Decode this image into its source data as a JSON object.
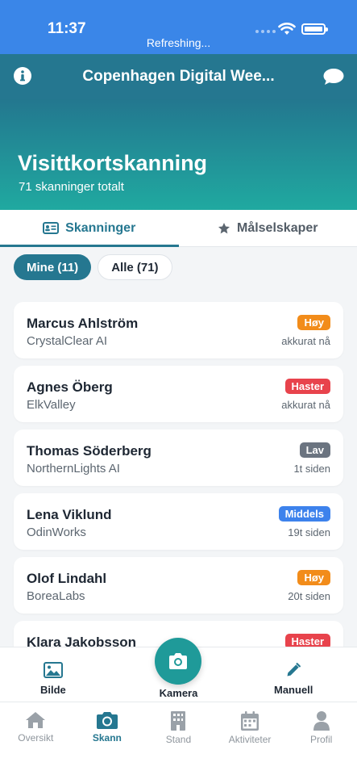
{
  "status_bar": {
    "time": "11:37",
    "refresh_text": "Refreshing..."
  },
  "navbar": {
    "title": "Copenhagen Digital Wee...",
    "left_icon": "info-icon",
    "right_icon": "chat-bubble-icon"
  },
  "hero": {
    "title": "Visittkortskanning",
    "subtitle": "71 skanninger totalt"
  },
  "tabs": [
    {
      "label": "Skanninger",
      "icon": "contact-card-icon",
      "active": true
    },
    {
      "label": "Målselskaper",
      "icon": "star-icon",
      "active": false
    }
  ],
  "filters": [
    {
      "label": "Mine (11)",
      "active": true
    },
    {
      "label": "Alle (71)",
      "active": false
    }
  ],
  "scans": [
    {
      "name": "Marcus Ahlström",
      "company": "CrystalClear AI",
      "priority": "Høy",
      "priority_color": "#f28c1a",
      "time": "akkurat nå"
    },
    {
      "name": "Agnes Öberg",
      "company": "ElkValley",
      "priority": "Haster",
      "priority_color": "#e8434c",
      "time": "akkurat nå"
    },
    {
      "name": "Thomas Söderberg",
      "company": "NorthernLights AI",
      "priority": "Lav",
      "priority_color": "#6b7480",
      "time": "1t siden"
    },
    {
      "name": "Lena Viklund",
      "company": "OdinWorks",
      "priority": "Middels",
      "priority_color": "#3d82ec",
      "time": "19t siden"
    },
    {
      "name": "Olof Lindahl",
      "company": "BoreaLabs",
      "priority": "Høy",
      "priority_color": "#f28c1a",
      "time": "20t siden"
    },
    {
      "name": "Klara Jakobsson",
      "company": "",
      "priority": "Haster",
      "priority_color": "#e8434c",
      "time": ""
    }
  ],
  "actions": {
    "bilde": "Bilde",
    "kamera": "Kamera",
    "manuell": "Manuell"
  },
  "tabbar": [
    {
      "label": "Oversikt",
      "icon": "home-icon",
      "active": false
    },
    {
      "label": "Skann",
      "icon": "camera-icon",
      "active": true
    },
    {
      "label": "Stand",
      "icon": "building-icon",
      "active": false
    },
    {
      "label": "Aktiviteter",
      "icon": "calendar-icon",
      "active": false
    },
    {
      "label": "Profil",
      "icon": "person-icon",
      "active": false
    }
  ],
  "colors": {
    "primary": "#257790",
    "status_bar": "#3a86e8",
    "accent": "#1f9a99"
  }
}
